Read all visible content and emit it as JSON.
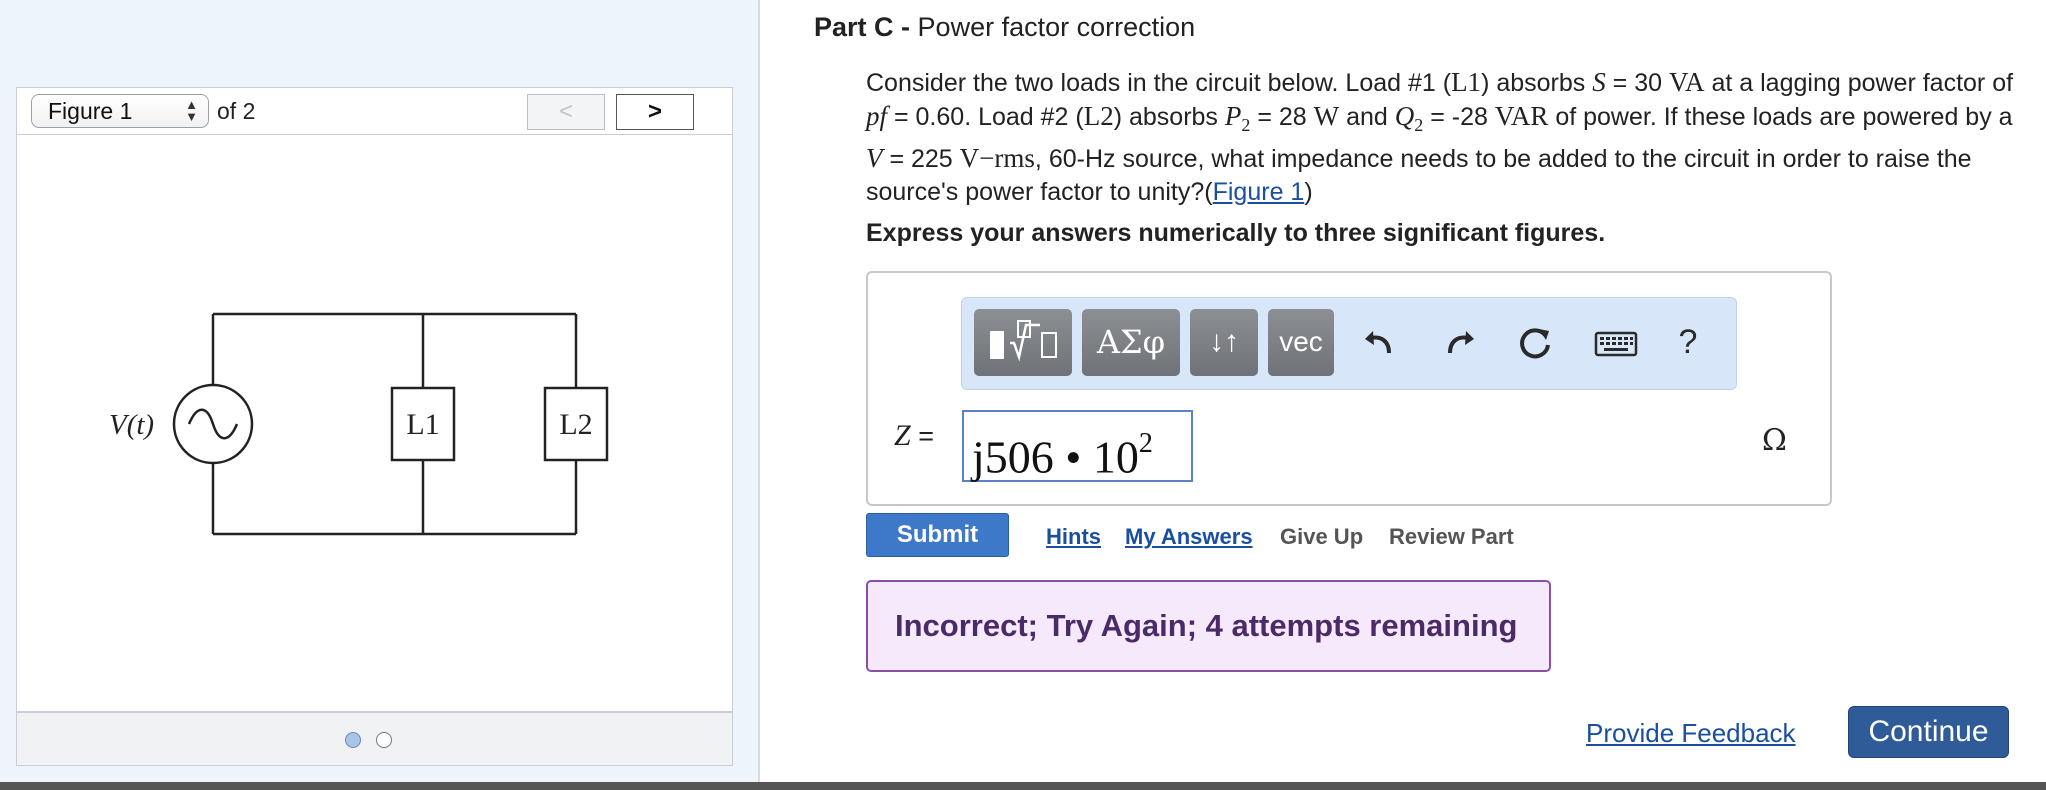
{
  "figure_panel": {
    "select_value": "Figure 1",
    "of_label": "of 2",
    "prev_label": "<",
    "next_label": ">",
    "pagination": {
      "total": 2,
      "current": 1
    },
    "circuit": {
      "source_label": "V(t)",
      "load1_label": "L1",
      "load2_label": "L2"
    }
  },
  "part": {
    "prefix": "Part C -",
    "title": "Power factor correction"
  },
  "question": {
    "load1": {
      "S": "30",
      "unit": "VA",
      "pf": "0.60"
    },
    "load2": {
      "P": "28",
      "P_unit": "W",
      "Q": "-28",
      "Q_unit": "VAR"
    },
    "source": {
      "V": "225",
      "unit": "V−rms",
      "freq": "60-Hz"
    },
    "figure_link": "Figure 1"
  },
  "instruction": "Express your answers numerically to three significant figures.",
  "toolbar": {
    "templates_icon": "templates-icon",
    "greek_label": "ΑΣφ",
    "arrows_label": "↓↑",
    "vec_label": "vec",
    "undo_icon": "undo-icon",
    "redo_icon": "redo-icon",
    "reset_icon": "reset-icon",
    "keyboard_icon": "keyboard-icon",
    "help_label": "?"
  },
  "answer": {
    "variable": "Z",
    "equals": "=",
    "value": "j506 • 10",
    "exponent": "2",
    "unit": "Ω"
  },
  "actions": {
    "submit": "Submit",
    "hints": "Hints",
    "my_answers": "My Answers",
    "give_up": "Give Up",
    "review_part": "Review Part"
  },
  "feedback": "Incorrect; Try Again; 4 attempts remaining",
  "footer": {
    "provide_feedback": "Provide Feedback",
    "continue": "Continue"
  },
  "colors": {
    "accent": "#3d78c9",
    "link": "#1a4fa0",
    "feedback_bg": "#f5e9fb",
    "feedback_border": "#8a4fa8",
    "toolbar_bg": "#d7e6f9"
  }
}
